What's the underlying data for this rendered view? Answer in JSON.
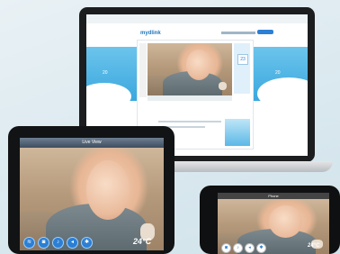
{
  "laptop": {
    "logo": "mydlink",
    "header_links": "",
    "date_card": "23",
    "temp_left": "20",
    "temp_right": "20"
  },
  "tablet": {
    "title": "Live View",
    "temperature": "24°C",
    "controls": [
      "wifi",
      "camera",
      "microphone",
      "speaker",
      "settings"
    ]
  },
  "phone": {
    "title": "Phone",
    "temperature": "24°C"
  },
  "colors": {
    "accent": "#2b7fd4",
    "sky": "#4ab3e6"
  }
}
